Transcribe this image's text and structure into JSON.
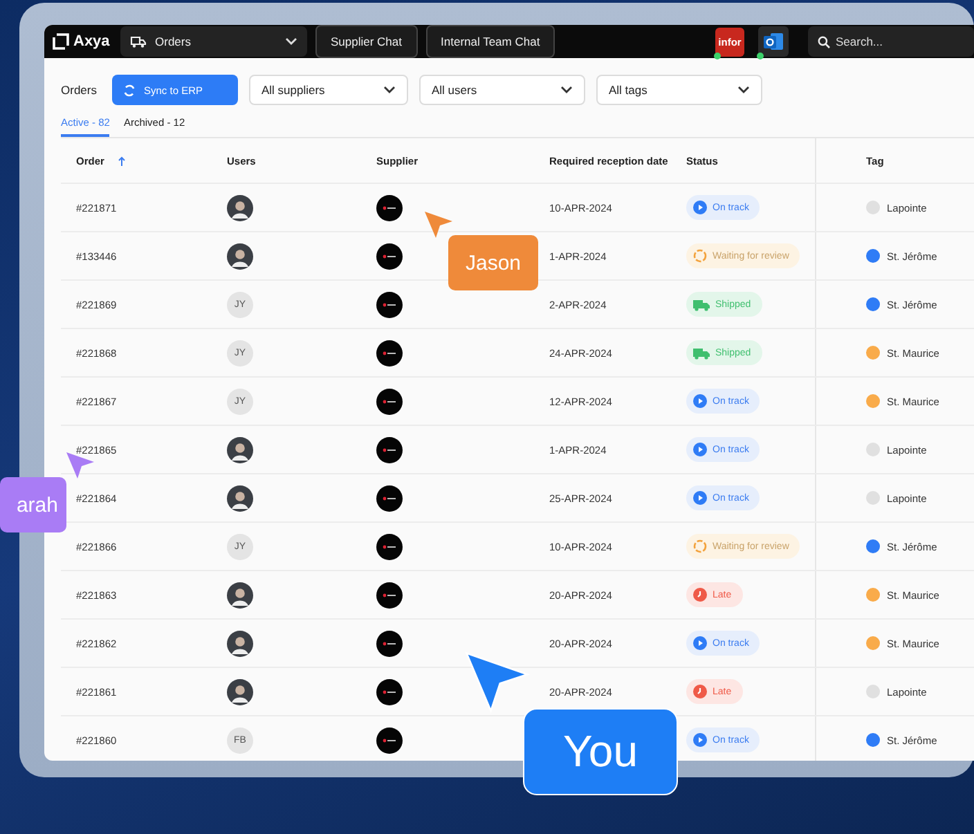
{
  "topbar": {
    "logo": "Axya",
    "nav": {
      "label": "Orders"
    },
    "buttons": [
      "Supplier Chat",
      "Internal Team Chat"
    ],
    "integrations": [
      {
        "kind": "infor",
        "label": "infor",
        "connected": true
      },
      {
        "kind": "outlook",
        "connected": true
      }
    ],
    "search": {
      "placeholder": "Search..."
    }
  },
  "filters": {
    "title": "Orders",
    "sync_button": "Sync to ERP",
    "dropdowns": [
      "All suppliers",
      "All users",
      "All tags"
    ]
  },
  "tabs": [
    {
      "label": "Active - 82",
      "selected": true
    },
    {
      "label": "Archived - 12",
      "selected": false
    }
  ],
  "table": {
    "columns": [
      "Order",
      "Users",
      "Supplier",
      "Required reception date",
      "Status",
      "Tag"
    ],
    "rows": [
      {
        "order": "#221871",
        "user": {
          "kind": "photo"
        },
        "date": "10-APR-2024",
        "status": {
          "kind": "on_track",
          "label": "On track"
        },
        "tag": {
          "label": "Lapointe",
          "color": "#e0e0e0"
        }
      },
      {
        "order": "#133446",
        "user": {
          "kind": "photo"
        },
        "date": "1-APR-2024",
        "status": {
          "kind": "waiting",
          "label": "Waiting for review"
        },
        "tag": {
          "label": "St. Jérôme",
          "color": "#2f7cf6"
        }
      },
      {
        "order": "#221869",
        "user": {
          "kind": "initials",
          "initials": "JY"
        },
        "date": "2-APR-2024",
        "status": {
          "kind": "shipped",
          "label": "Shipped"
        },
        "tag": {
          "label": "St. Jérôme",
          "color": "#2f7cf6"
        }
      },
      {
        "order": "#221868",
        "user": {
          "kind": "initials",
          "initials": "JY"
        },
        "date": "24-APR-2024",
        "status": {
          "kind": "shipped",
          "label": "Shipped"
        },
        "tag": {
          "label": "St. Maurice",
          "color": "#f9ab4a"
        }
      },
      {
        "order": "#221867",
        "user": {
          "kind": "initials",
          "initials": "JY"
        },
        "date": "12-APR-2024",
        "status": {
          "kind": "on_track",
          "label": "On track"
        },
        "tag": {
          "label": "St. Maurice",
          "color": "#f9ab4a"
        }
      },
      {
        "order": "#221865",
        "user": {
          "kind": "photo"
        },
        "date": "1-APR-2024",
        "status": {
          "kind": "on_track",
          "label": "On track"
        },
        "tag": {
          "label": "Lapointe",
          "color": "#e0e0e0"
        }
      },
      {
        "order": "#221864",
        "user": {
          "kind": "photo"
        },
        "date": "25-APR-2024",
        "status": {
          "kind": "on_track",
          "label": "On track"
        },
        "tag": {
          "label": "Lapointe",
          "color": "#e0e0e0"
        }
      },
      {
        "order": "#221866",
        "user": {
          "kind": "initials",
          "initials": "JY"
        },
        "date": "10-APR-2024",
        "status": {
          "kind": "waiting",
          "label": "Waiting for review"
        },
        "tag": {
          "label": "St. Jérôme",
          "color": "#2f7cf6"
        }
      },
      {
        "order": "#221863",
        "user": {
          "kind": "photo"
        },
        "date": "20-APR-2024",
        "status": {
          "kind": "late",
          "label": "Late"
        },
        "tag": {
          "label": "St. Maurice",
          "color": "#f9ab4a"
        }
      },
      {
        "order": "#221862",
        "user": {
          "kind": "photo"
        },
        "date": "20-APR-2024",
        "status": {
          "kind": "on_track",
          "label": "On track"
        },
        "tag": {
          "label": "St. Maurice",
          "color": "#f9ab4a"
        }
      },
      {
        "order": "#221861",
        "user": {
          "kind": "photo"
        },
        "date": "20-APR-2024",
        "status": {
          "kind": "late",
          "label": "Late"
        },
        "tag": {
          "label": "Lapointe",
          "color": "#e0e0e0"
        }
      },
      {
        "order": "#221860",
        "user": {
          "kind": "initials",
          "initials": "FB"
        },
        "status": {
          "kind": "on_track",
          "label": "On track"
        },
        "tag": {
          "label": "St. Jérôme",
          "color": "#2f7cf6"
        }
      }
    ]
  },
  "cursors": [
    {
      "label": "Jason",
      "color": "#ef8a3a"
    },
    {
      "label": "arah",
      "color": "#a97cf5"
    },
    {
      "label": "You",
      "color": "#1e7ef5"
    }
  ]
}
